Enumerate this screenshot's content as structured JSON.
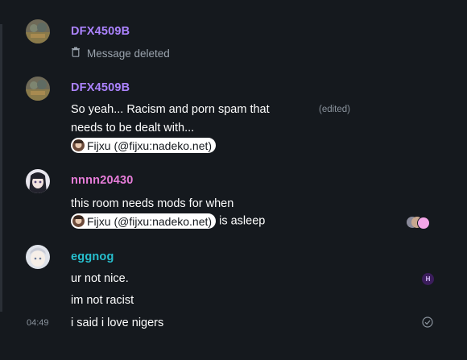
{
  "colors": {
    "background": "#15191e",
    "sender_purple": "#ac83ff",
    "sender_pink": "#e77dd9",
    "sender_teal": "#27c0cf",
    "muted": "#9aa3ad"
  },
  "messages": [
    {
      "sender": "DFX4509B",
      "deleted_text": "Message deleted"
    },
    {
      "sender": "DFX4509B",
      "line1": "So yeah... Racism and porn spam that",
      "line2": "needs to be dealt with...",
      "edited": "(edited)",
      "mention": "Fijxu (@fijxu:nadeko.net)"
    },
    {
      "sender": "nnnn20430",
      "line1": "this room needs mods for when",
      "mention": "Fijxu (@fijxu:nadeko.net)",
      "after_mention": "is asleep"
    },
    {
      "sender": "eggnog",
      "line1": "ur not nice.",
      "line2": "im not racist",
      "line3": "i said i love nigers",
      "timestamp": "04:49",
      "receipt_initial": "H"
    }
  ]
}
